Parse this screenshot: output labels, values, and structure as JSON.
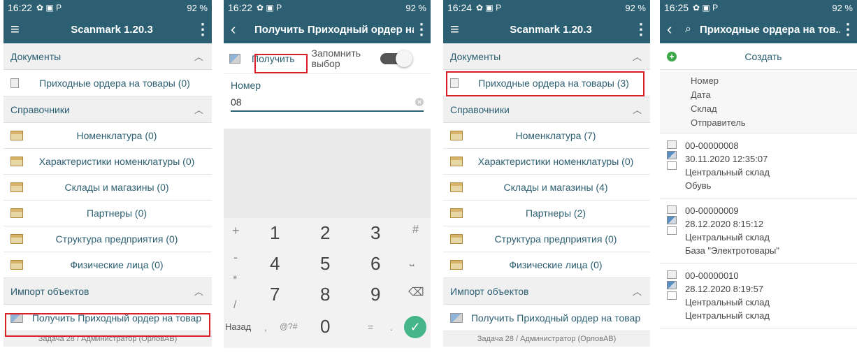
{
  "colors": {
    "accent": "#2c5f72",
    "highlight": "#d8202a",
    "ok": "#45b58a"
  },
  "screen1": {
    "status": {
      "time": "16:22",
      "battery": "92 %"
    },
    "appbar": {
      "title": "Scanmark 1.20.3"
    },
    "sections": [
      {
        "title": "Документы",
        "items": [
          "Приходные ордера на товары (0)"
        ]
      },
      {
        "title": "Справочники",
        "items": [
          "Номенклатура (0)",
          "Характеристики номенклатуры (0)",
          "Склады и магазины (0)",
          "Партнеры (0)",
          "Структура предприятия (0)",
          "Физические лица (0)"
        ]
      },
      {
        "title": "Импорт объектов",
        "items": [
          "Получить Приходный ордер на товар"
        ]
      }
    ],
    "footer": "Задача 28 / Администратор (ОрловАВ)"
  },
  "screen2": {
    "status": {
      "time": "16:22",
      "battery": "92 %"
    },
    "appbar": {
      "title": "Получить Приходный ордер на..."
    },
    "get_button": "Получить",
    "remember": "Запомнить выбор",
    "field_label": "Номер",
    "field_value": "08",
    "keys": {
      "left": [
        "+",
        "-",
        "*",
        "/"
      ],
      "digits": [
        "1",
        "2",
        "3",
        "4",
        "5",
        "6",
        "7",
        "8",
        "9"
      ],
      "right_top": "#",
      "bottom": [
        "Назад",
        ",",
        "@?#",
        "0",
        "=",
        "."
      ]
    }
  },
  "screen3": {
    "status": {
      "time": "16:24",
      "battery": "92 %"
    },
    "appbar": {
      "title": "Scanmark 1.20.3"
    },
    "sections": [
      {
        "title": "Документы",
        "items": [
          "Приходные ордера на товары (3)"
        ]
      },
      {
        "title": "Справочники",
        "items": [
          "Номенклатура (7)",
          "Характеристики номенклатуры (0)",
          "Склады и магазины (4)",
          "Партнеры (2)",
          "Структура предприятия (0)",
          "Физические лица (0)"
        ]
      },
      {
        "title": "Импорт объектов",
        "items": [
          "Получить Приходный ордер на товар"
        ]
      }
    ],
    "footer": "Задача 28 / Администратор (ОрловАВ)"
  },
  "screen4": {
    "status": {
      "time": "16:25",
      "battery": "92 %"
    },
    "appbar": {
      "title": "Приходные ордера на тов..."
    },
    "create_label": "Создать",
    "headers": [
      "Номер",
      "Дата",
      "Склад",
      "Отправитель"
    ],
    "records": [
      {
        "number": "00-00000008",
        "date": "30.11.2020 12:35:07",
        "warehouse": "Центральный склад",
        "sender": "Обувь"
      },
      {
        "number": "00-00000009",
        "date": "28.12.2020 8:15:12",
        "warehouse": "Центральный склад",
        "sender": "База \"Электротовары\""
      },
      {
        "number": "00-00000010",
        "date": "28.12.2020 8:19:57",
        "warehouse": "Центральный склад",
        "sender": "Центральный склад"
      }
    ]
  }
}
